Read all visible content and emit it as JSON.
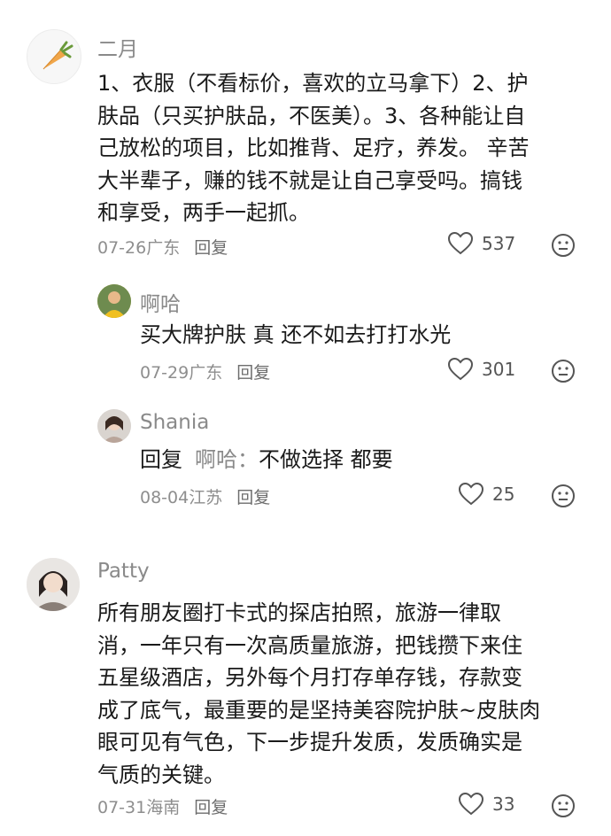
{
  "comments": [
    {
      "username": "二月",
      "avatar_icon": "carrot-icon",
      "content": "1、衣服（不看标价，喜欢的立马拿下）2、护肤品（只买护肤品，不医美）。3、各种能让自己放松的项目，比如推背、足疗，养发。 辛苦大半辈子，赚的钱不就是让自己享受吗。搞钱和享受，两手一起抓。",
      "lines": [
        "1、衣服（不看标价，喜欢的立马拿下）2、护",
        "肤品（只买护肤品，不医美）。3、各种能让自",
        "己放松的项目，比如推背、足疗，养发。 辛苦",
        "大半辈子，赚的钱不就是让自己享受吗。搞钱",
        "和享受，两手一起抓。"
      ],
      "date": "07-26",
      "location": "广东",
      "reply_label": "回复",
      "likes": "537"
    },
    {
      "username": "啊哈",
      "avatar_icon": "user-avatar",
      "content": "买大牌护肤 真 还不如去打打水光",
      "date": "07-29",
      "location": "广东",
      "reply_label": "回复",
      "likes": "301"
    },
    {
      "username": "Shania",
      "avatar_icon": "user-avatar",
      "reply_prefix": "回复",
      "reply_target": "啊哈：",
      "content": "不做选择 都要",
      "date": "08-04",
      "location": "江苏",
      "reply_label": "回复",
      "likes": "25"
    },
    {
      "username": "Patty",
      "avatar_icon": "user-avatar",
      "content": "所有朋友圈打卡式的探店拍照，旅游一律取消，一年只有一次高质量旅游，把钱攒下来住五星级酒店，另外每个月打存单存钱，存款变成了底气，最重要的是坚持美容院护肤~皮肤肉眼可见有气色，下一步提升发质，发质确实是气质的关键。",
      "lines": [
        "所有朋友圈打卡式的探店拍照，旅游一律取",
        "消，一年只有一次高质量旅游，把钱攒下来住",
        "五星级酒店，另外每个月打存单存钱，存款变",
        "成了底气，最重要的是坚持美容院护肤~皮肤肉",
        "眼可见有气色，下一步提升发质，发质确实是",
        "气质的关键。"
      ],
      "date": "07-31",
      "location": "海南",
      "reply_label": "回复",
      "likes": "33"
    }
  ]
}
